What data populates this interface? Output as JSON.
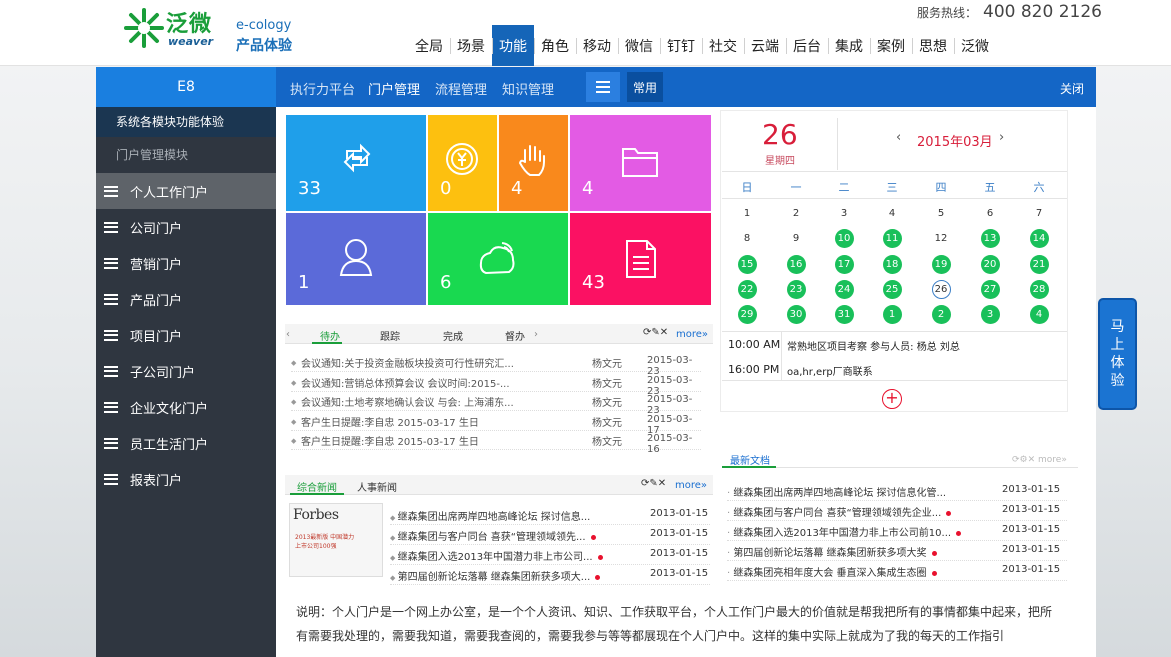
{
  "header": {
    "logo_cn": "泛微",
    "logo_en": "weaver",
    "product_top": "e-cology",
    "product_bottom": "产品体验",
    "hotline_label": "服务热线：",
    "hotline_number": "400 820 2126",
    "nav": [
      "全局",
      "场景",
      "功能",
      "角色",
      "移动",
      "微信",
      "钉钉",
      "社交",
      "云端",
      "后台",
      "集成",
      "案例",
      "思想",
      "泛微"
    ],
    "nav_active": "功能"
  },
  "sidebar": {
    "title": "E8",
    "section1": "系统各模块功能体验",
    "section2": "门户管理模块",
    "items": [
      "个人工作门户",
      "公司门户",
      "营销门户",
      "产品门户",
      "项目门户",
      "子公司门户",
      "企业文化门户",
      "员工生活门户",
      "报表门户"
    ],
    "active": "个人工作门户"
  },
  "content_header": {
    "tabs": [
      "执行力平台",
      "门户管理",
      "流程管理",
      "知识管理"
    ],
    "active_tab": "门户管理",
    "common_label": "常用",
    "close_label": "关闭"
  },
  "tiles": [
    {
      "value": "33",
      "icon": "refresh-icon",
      "color": "#1f9fea"
    },
    {
      "value": "0",
      "icon": "coin-icon",
      "color": "#fdc00f"
    },
    {
      "value": "4",
      "icon": "hand-icon",
      "color": "#f9891c"
    },
    {
      "value": "4",
      "icon": "folder-icon",
      "color": "#e35be4"
    },
    {
      "value": "1",
      "icon": "person-icon",
      "color": "#5b6ad9"
    },
    {
      "value": "6",
      "icon": "chat-icon",
      "color": "#19d950"
    },
    {
      "value": "43",
      "icon": "document-icon",
      "color": "#fb1163"
    }
  ],
  "todo": {
    "tabs": [
      "待办",
      "跟踪",
      "完成",
      "督办"
    ],
    "active": "待办",
    "more": "more",
    "rows": [
      {
        "title": "会议通知:关于投资金融板块投资可行性研究汇...",
        "user": "杨文元",
        "date": "2015-03-23"
      },
      {
        "title": "会议通知:营销总体预算会议 会议时间:2015-...",
        "user": "杨文元",
        "date": "2015-03-23"
      },
      {
        "title": "会议通知:土地考察地确认会议 与会: 上海浦东...",
        "user": "杨文元",
        "date": "2015-03-23"
      },
      {
        "title": "客户生日提醒:李自忠 2015-03-17 生日",
        "user": "杨文元",
        "date": "2015-03-17"
      },
      {
        "title": "客户生日提醒:李自忠 2015-03-17 生日",
        "user": "杨文元",
        "date": "2015-03-16"
      }
    ]
  },
  "calendar": {
    "day": "26",
    "weekday": "星期四",
    "month": "2015年03月",
    "prev": "‹",
    "next": "›",
    "headers": [
      "日",
      "一",
      "二",
      "三",
      "四",
      "五",
      "六"
    ],
    "days": [
      [
        "1",
        "2",
        "3",
        "4",
        "5",
        "6",
        "7"
      ],
      [
        "8",
        "9",
        "10",
        "11",
        "12",
        "13",
        "14"
      ],
      [
        "15",
        "16",
        "17",
        "18",
        "19",
        "20",
        "21"
      ],
      [
        "22",
        "23",
        "24",
        "25",
        "26",
        "27",
        "28"
      ],
      [
        "29",
        "30",
        "31",
        "1",
        "2",
        "3",
        "4"
      ]
    ],
    "events": [
      {
        "time": "10:00 AM",
        "text": "常熟地区项目考察 参与人员: 杨总 刘总"
      },
      {
        "time": "16:00 PM",
        "text": "oa,hr,erp厂商联系"
      }
    ],
    "add": "+"
  },
  "news": {
    "tabs": [
      "综合新闻",
      "人事新闻"
    ],
    "active": "综合新闻",
    "more": "more",
    "thumb_title": "Forbes",
    "thumb_sub": "2013最新版 中国潜力上市公司100强",
    "rows": [
      {
        "title": "继森集团出席两岸四地高峰论坛 探讨信息...",
        "date": "2013-01-15",
        "dot": false
      },
      {
        "title": "继森集团与客户同台 喜获“管理领域领先...",
        "date": "2013-01-15",
        "dot": true
      },
      {
        "title": "继森集团入选2013年中国潜力非上市公司...",
        "date": "2013-01-15",
        "dot": true
      },
      {
        "title": "第四届创新论坛落幕 继森集团新获多项大...",
        "date": "2013-01-15",
        "dot": true
      }
    ]
  },
  "docs": {
    "title": "最新文档",
    "more": "more",
    "rows": [
      {
        "title": "继森集团出席两岸四地高峰论坛 探讨信息化管...",
        "date": "2013-01-15",
        "dot": false
      },
      {
        "title": "继森集团与客户同台 喜获“管理领域领先企业...",
        "date": "2013-01-15",
        "dot": true
      },
      {
        "title": "继森集团入选2013年中国潜力非上市公司前10...",
        "date": "2013-01-15",
        "dot": true
      },
      {
        "title": "第四届创新论坛落幕 继森集团新获多项大奖",
        "date": "2013-01-15",
        "dot": true
      },
      {
        "title": "继森集团亮相年度大会 垂直深入集成生态圈",
        "date": "2013-01-15",
        "dot": true
      }
    ]
  },
  "description": {
    "line1": "说明：个人门户是一个网上办公室，是一个个人资讯、知识、工作获取平台，个人工作门户最大的价值就是帮我把所有的事情都集中起来，把所",
    "line2": "有需要我处理的，需要我知道，需要我查阅的，需要我参与等等都展现在个人门户中。这样的集中实际上就成为了我的每天的工作指引"
  },
  "try_button": "马上体验"
}
